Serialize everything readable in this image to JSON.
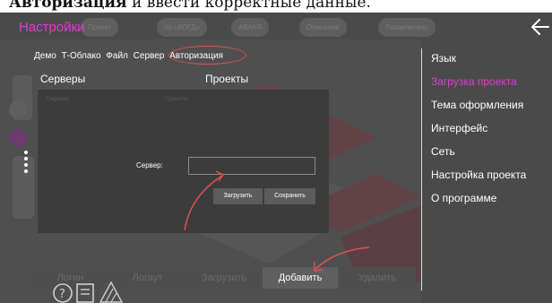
{
  "doc": {
    "caption_bold": "Авторизация",
    "caption_rest": " и ввести корректные данные."
  },
  "header": {
    "title": "Настройки",
    "ghost_tabs": [
      "Проект",
      "по «КОГД»",
      "АВАКЯ",
      "Описание",
      "Разделитель"
    ]
  },
  "menu": {
    "items": [
      "Демо",
      "Т-Облако",
      "Файл",
      "Сервер",
      "Авторизация"
    ]
  },
  "columns": {
    "servers": "Серверы",
    "projects": "Проекты"
  },
  "dialog": {
    "faint_servers": "Серверы",
    "faint_projects": "Проекты",
    "server_label": "Сервер:",
    "server_value": "",
    "load_label": "Загрузить",
    "save_label": "Сохранить"
  },
  "bottom": {
    "buttons": [
      "Логин",
      "Логаут",
      "Загрузить",
      "Добавить",
      "Удалить"
    ],
    "active": "Добавить"
  },
  "right_panel": {
    "items": [
      "Язык",
      "Загрузка проекта",
      "Тема оформления",
      "Интерфейс",
      "Сеть",
      "Настройка проекта",
      "О программе"
    ],
    "active": "Загрузка проекта"
  },
  "colors": {
    "accent": "#e23ad6",
    "annotation": "#e0504d",
    "background": "#4a4a4a",
    "dialog": "#3c3c3c"
  },
  "icons": {
    "back": "back-arrow-icon",
    "help": "help-icon",
    "document": "document-icon",
    "menu": "more-vertical-icon"
  }
}
